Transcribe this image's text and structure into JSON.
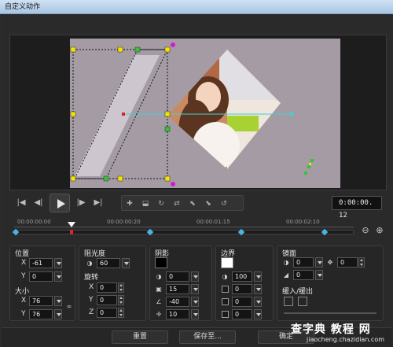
{
  "window": {
    "title": "自定义动作"
  },
  "preview": {
    "colors": {
      "canvas_bg": "#a59ba5",
      "handle_yellow": "#f6e400",
      "handle_green": "#37c23a",
      "handle_magenta": "#d01ad0",
      "path_cyan": "#3fd0d8",
      "anchor_red": "#e02020"
    }
  },
  "playback": {
    "icons": [
      "skip-to-start-icon",
      "prev-frame-icon",
      "play-icon",
      "next-frame-icon",
      "skip-to-end-icon"
    ],
    "timecode": "0:00:00. 12"
  },
  "timeline": {
    "ticks": [
      "00:00:00:00",
      "00:00:00:20",
      "00:00:01:15",
      "00:00:02:10"
    ]
  },
  "properties": {
    "position": {
      "label": "位置",
      "x_label": "X",
      "x": "-61",
      "y_label": "Y",
      "y": "0"
    },
    "size": {
      "label": "大小",
      "x_label": "X",
      "x": "76",
      "y_label": "Y",
      "y": "76"
    },
    "opacity": {
      "label": "阻光度",
      "value": "60"
    },
    "rotation": {
      "label": "旋转",
      "x_label": "X",
      "x": "0",
      "y_label": "Y",
      "y": "0",
      "z_label": "Z",
      "z": "0"
    },
    "shadow": {
      "label": "阴影",
      "color": "#000000",
      "opacity": "0",
      "blur": "15",
      "angle": "-40",
      "distance": "10"
    },
    "border": {
      "label": "边界",
      "color": "#ffffff",
      "opacity": "100",
      "size": "0",
      "v1": "0",
      "v2": "0"
    },
    "mirror": {
      "label": "镜面",
      "v1": "0",
      "v2": "0",
      "v3": "0"
    },
    "fade": {
      "label": "缓入/缓出"
    }
  },
  "buttons": {
    "reset": "重置",
    "save_to": "保存至...",
    "ok": "确定"
  },
  "watermark": {
    "line1": "查字典 教程 网",
    "line2": "jiaocheng.chazidian.com"
  }
}
